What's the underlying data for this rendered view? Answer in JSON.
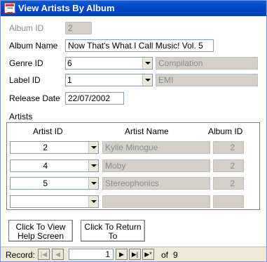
{
  "window": {
    "title": "View Artists By Album"
  },
  "form": {
    "album_id": {
      "label": "Album ID",
      "value": "2"
    },
    "album_name": {
      "label": "Album Name",
      "value": "Now That's What I Call Music! Vol. 5"
    },
    "genre": {
      "label": "Genre ID",
      "value": "6",
      "name": "Compilation"
    },
    "label_id": {
      "label": "Label ID",
      "value": "1",
      "name": "EMI"
    },
    "release_date": {
      "label": "Release Date",
      "value": "22/07/2002"
    }
  },
  "artists": {
    "section_label": "Artists",
    "columns": [
      "Artist ID",
      "Artist Name",
      "Album ID"
    ],
    "rows": [
      {
        "artist_id": "2",
        "artist_name": "Kylie Minogue",
        "album_id": "2"
      },
      {
        "artist_id": "4",
        "artist_name": "Moby",
        "album_id": "2"
      },
      {
        "artist_id": "5",
        "artist_name": "Stereophonics",
        "album_id": "2"
      },
      {
        "artist_id": "",
        "artist_name": "",
        "album_id": ""
      }
    ]
  },
  "buttons": {
    "help": "Click To View Help Screen",
    "return": "Click To Return To"
  },
  "navigation": {
    "record_label": "Record:",
    "current": "1",
    "of_label": "of",
    "total": "9",
    "first_icon": "first-record-icon",
    "prev_icon": "previous-record-icon",
    "next_icon": "next-record-icon",
    "last_icon": "last-record-icon",
    "new_icon": "new-record-icon"
  },
  "colors": {
    "title_bar": "#0046c7",
    "readonly_bg": "#d4d0c8",
    "window_bg": "#ece9d8"
  }
}
